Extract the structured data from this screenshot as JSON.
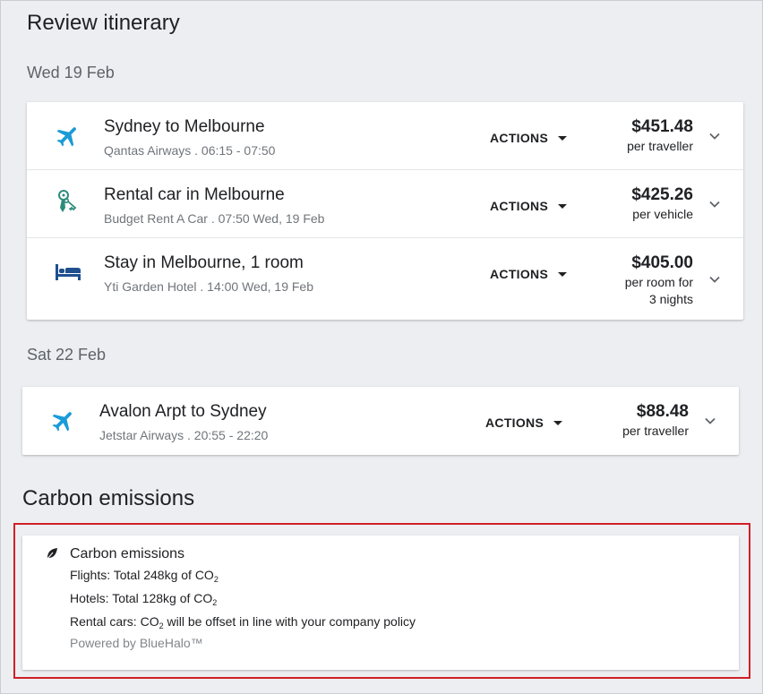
{
  "page": {
    "title": "Review itinerary"
  },
  "days": [
    {
      "date": "Wed 19 Feb",
      "items": [
        {
          "icon": "plane-icon",
          "title": "Sydney to Melbourne",
          "subtitle": "Qantas Airways . 06:15 - 07:50",
          "actions_label": "ACTIONS",
          "price": "$451.48",
          "price_note": "per traveller"
        },
        {
          "icon": "car-keys-icon",
          "title": "Rental car in Melbourne",
          "subtitle": "Budget Rent A Car . 07:50 Wed, 19 Feb",
          "actions_label": "ACTIONS",
          "price": "$425.26",
          "price_note": "per vehicle"
        },
        {
          "icon": "bed-icon",
          "title": "Stay in Melbourne, 1 room",
          "subtitle": "Yti Garden Hotel . 14:00 Wed, 19 Feb",
          "actions_label": "ACTIONS",
          "price": "$405.00",
          "price_note_line1": "per room for",
          "price_note_line2": "3 nights"
        }
      ]
    },
    {
      "date": "Sat 22 Feb",
      "items": [
        {
          "icon": "plane-icon",
          "title": "Avalon Arpt to Sydney",
          "subtitle": "Jetstar Airways . 20:55 - 22:20",
          "actions_label": "ACTIONS",
          "price": "$88.48",
          "price_note": "per traveller"
        }
      ]
    }
  ],
  "carbon": {
    "section_title": "Carbon emissions",
    "card_title": "Carbon emissions",
    "flights_prefix": "Flights: Total 248kg of CO",
    "hotels_prefix": "Hotels: Total 128kg of CO",
    "rental_prefix": "Rental cars: CO",
    "rental_suffix": " will be offset in line with your company policy",
    "subscript": "2",
    "powered_by": "Powered by BlueHalo™",
    "icon": "leaf-icon"
  },
  "colors": {
    "plane_icon": "#1a9bd7",
    "car_icon": "#2e8b7a",
    "bed_icon": "#1f4f8f",
    "highlight_border": "#d21f27"
  }
}
